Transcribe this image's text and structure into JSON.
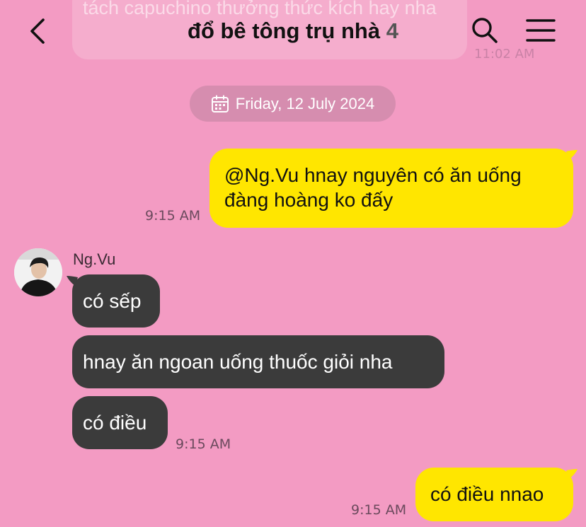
{
  "header": {
    "title": "đổ bê tông trụ nhà",
    "member_count": "4"
  },
  "previous_message": {
    "text": "tách capuchino thưởng thức kích hay nha",
    "time": "11:02 AM"
  },
  "date_divider": {
    "label": "Friday, 12 July 2024"
  },
  "messages": [
    {
      "direction": "out",
      "text": "@Ng.Vu hnay nguyên có ăn uống đàng hoàng ko đấy",
      "time": "9:15 AM"
    },
    {
      "direction": "in",
      "sender": "Ng.Vu",
      "text": "có sếp"
    },
    {
      "direction": "in",
      "text": "hnay ăn ngoan uống thuốc giỏi nha"
    },
    {
      "direction": "in",
      "text": "có điều",
      "time": "9:15 AM"
    },
    {
      "direction": "out",
      "text": "có điều nnao",
      "time": "9:15 AM"
    }
  ],
  "colors": {
    "background": "#f39bc3",
    "outgoing_bubble": "#ffe600",
    "incoming_bubble": "#3b3b3b"
  },
  "icons": {
    "back": "chevron-left-icon",
    "search": "search-icon",
    "menu": "hamburger-menu-icon",
    "calendar": "calendar-icon"
  }
}
